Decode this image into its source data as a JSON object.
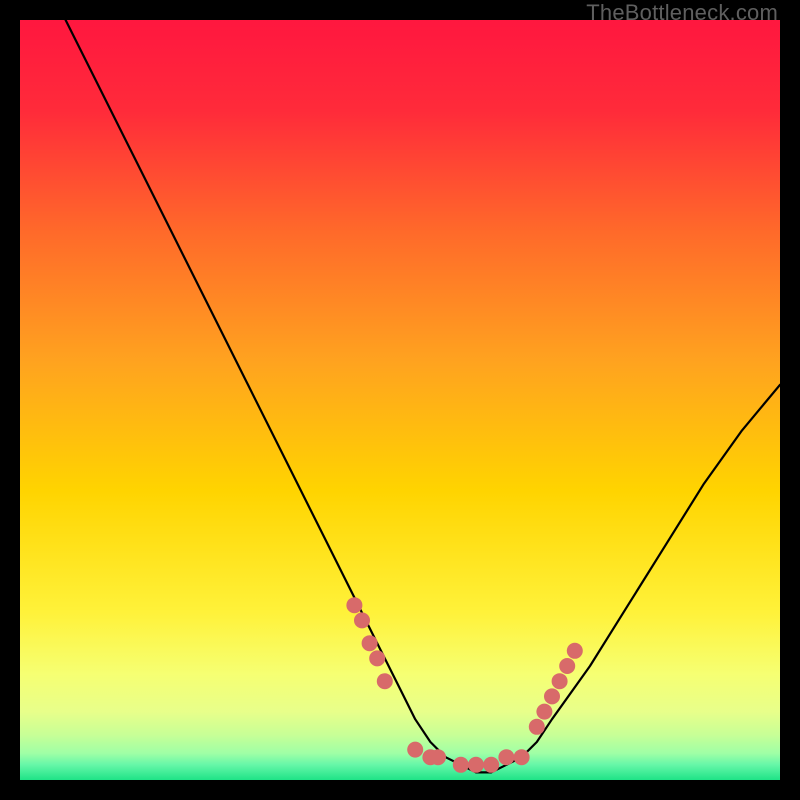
{
  "watermark": "TheBottleneck.com",
  "colors": {
    "background": "#000000",
    "gradient_top": "#ff1a3a",
    "gradient_mid_upper": "#ff6a2a",
    "gradient_mid": "#ffd400",
    "gradient_lower": "#f8ff66",
    "gradient_bottom1": "#d4ff80",
    "gradient_bottom2": "#6fffb0",
    "gradient_bottom3": "#00e880",
    "curve": "#000000",
    "dots": "#d86a6a"
  },
  "chart_data": {
    "type": "line",
    "title": "",
    "xlabel": "",
    "ylabel": "",
    "xlim": [
      0,
      100
    ],
    "ylim": [
      0,
      100
    ],
    "grid": false,
    "legend": false,
    "series": [
      {
        "name": "bottleneck-curve",
        "x": [
          6,
          10,
          15,
          20,
          25,
          30,
          35,
          40,
          45,
          48,
          50,
          52,
          54,
          56,
          58,
          60,
          62,
          64,
          66,
          68,
          70,
          75,
          80,
          85,
          90,
          95,
          100
        ],
        "y": [
          100,
          92,
          82,
          72,
          62,
          52,
          42,
          32,
          22,
          16,
          12,
          8,
          5,
          3,
          2,
          1,
          1,
          2,
          3,
          5,
          8,
          15,
          23,
          31,
          39,
          46,
          52
        ]
      }
    ],
    "markers": [
      {
        "name": "left-cluster",
        "x": [
          44,
          45,
          46,
          47,
          48
        ],
        "y": [
          23,
          21,
          18,
          16,
          13
        ]
      },
      {
        "name": "bottom-cluster",
        "x": [
          52,
          54,
          55,
          58,
          60,
          62,
          64,
          66
        ],
        "y": [
          4,
          3,
          3,
          2,
          2,
          2,
          3,
          3
        ]
      },
      {
        "name": "right-cluster",
        "x": [
          68,
          69,
          70,
          71,
          72,
          73
        ],
        "y": [
          7,
          9,
          11,
          13,
          15,
          17
        ]
      }
    ]
  }
}
